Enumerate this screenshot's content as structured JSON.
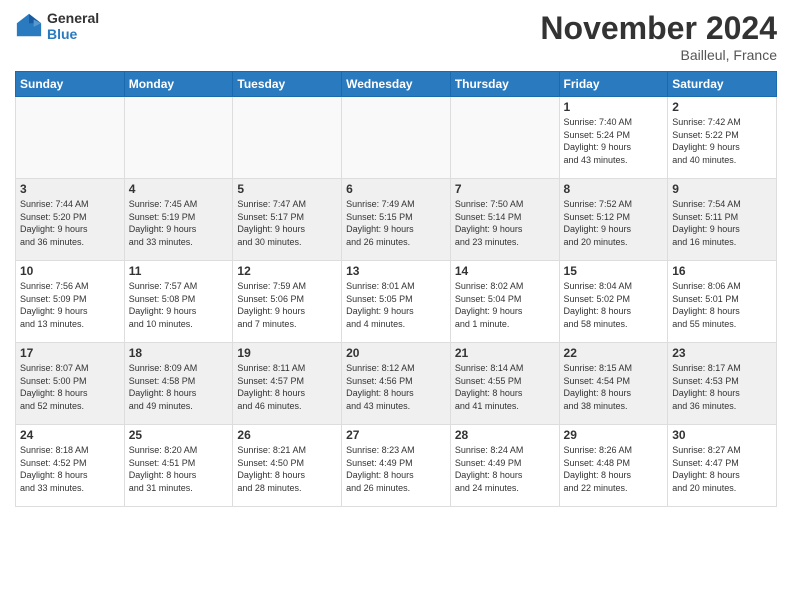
{
  "header": {
    "logo_line1": "General",
    "logo_line2": "Blue",
    "month": "November 2024",
    "location": "Bailleul, France"
  },
  "weekdays": [
    "Sunday",
    "Monday",
    "Tuesday",
    "Wednesday",
    "Thursday",
    "Friday",
    "Saturday"
  ],
  "weeks": [
    [
      {
        "day": "",
        "info": ""
      },
      {
        "day": "",
        "info": ""
      },
      {
        "day": "",
        "info": ""
      },
      {
        "day": "",
        "info": ""
      },
      {
        "day": "",
        "info": ""
      },
      {
        "day": "1",
        "info": "Sunrise: 7:40 AM\nSunset: 5:24 PM\nDaylight: 9 hours\nand 43 minutes."
      },
      {
        "day": "2",
        "info": "Sunrise: 7:42 AM\nSunset: 5:22 PM\nDaylight: 9 hours\nand 40 minutes."
      }
    ],
    [
      {
        "day": "3",
        "info": "Sunrise: 7:44 AM\nSunset: 5:20 PM\nDaylight: 9 hours\nand 36 minutes."
      },
      {
        "day": "4",
        "info": "Sunrise: 7:45 AM\nSunset: 5:19 PM\nDaylight: 9 hours\nand 33 minutes."
      },
      {
        "day": "5",
        "info": "Sunrise: 7:47 AM\nSunset: 5:17 PM\nDaylight: 9 hours\nand 30 minutes."
      },
      {
        "day": "6",
        "info": "Sunrise: 7:49 AM\nSunset: 5:15 PM\nDaylight: 9 hours\nand 26 minutes."
      },
      {
        "day": "7",
        "info": "Sunrise: 7:50 AM\nSunset: 5:14 PM\nDaylight: 9 hours\nand 23 minutes."
      },
      {
        "day": "8",
        "info": "Sunrise: 7:52 AM\nSunset: 5:12 PM\nDaylight: 9 hours\nand 20 minutes."
      },
      {
        "day": "9",
        "info": "Sunrise: 7:54 AM\nSunset: 5:11 PM\nDaylight: 9 hours\nand 16 minutes."
      }
    ],
    [
      {
        "day": "10",
        "info": "Sunrise: 7:56 AM\nSunset: 5:09 PM\nDaylight: 9 hours\nand 13 minutes."
      },
      {
        "day": "11",
        "info": "Sunrise: 7:57 AM\nSunset: 5:08 PM\nDaylight: 9 hours\nand 10 minutes."
      },
      {
        "day": "12",
        "info": "Sunrise: 7:59 AM\nSunset: 5:06 PM\nDaylight: 9 hours\nand 7 minutes."
      },
      {
        "day": "13",
        "info": "Sunrise: 8:01 AM\nSunset: 5:05 PM\nDaylight: 9 hours\nand 4 minutes."
      },
      {
        "day": "14",
        "info": "Sunrise: 8:02 AM\nSunset: 5:04 PM\nDaylight: 9 hours\nand 1 minute."
      },
      {
        "day": "15",
        "info": "Sunrise: 8:04 AM\nSunset: 5:02 PM\nDaylight: 8 hours\nand 58 minutes."
      },
      {
        "day": "16",
        "info": "Sunrise: 8:06 AM\nSunset: 5:01 PM\nDaylight: 8 hours\nand 55 minutes."
      }
    ],
    [
      {
        "day": "17",
        "info": "Sunrise: 8:07 AM\nSunset: 5:00 PM\nDaylight: 8 hours\nand 52 minutes."
      },
      {
        "day": "18",
        "info": "Sunrise: 8:09 AM\nSunset: 4:58 PM\nDaylight: 8 hours\nand 49 minutes."
      },
      {
        "day": "19",
        "info": "Sunrise: 8:11 AM\nSunset: 4:57 PM\nDaylight: 8 hours\nand 46 minutes."
      },
      {
        "day": "20",
        "info": "Sunrise: 8:12 AM\nSunset: 4:56 PM\nDaylight: 8 hours\nand 43 minutes."
      },
      {
        "day": "21",
        "info": "Sunrise: 8:14 AM\nSunset: 4:55 PM\nDaylight: 8 hours\nand 41 minutes."
      },
      {
        "day": "22",
        "info": "Sunrise: 8:15 AM\nSunset: 4:54 PM\nDaylight: 8 hours\nand 38 minutes."
      },
      {
        "day": "23",
        "info": "Sunrise: 8:17 AM\nSunset: 4:53 PM\nDaylight: 8 hours\nand 36 minutes."
      }
    ],
    [
      {
        "day": "24",
        "info": "Sunrise: 8:18 AM\nSunset: 4:52 PM\nDaylight: 8 hours\nand 33 minutes."
      },
      {
        "day": "25",
        "info": "Sunrise: 8:20 AM\nSunset: 4:51 PM\nDaylight: 8 hours\nand 31 minutes."
      },
      {
        "day": "26",
        "info": "Sunrise: 8:21 AM\nSunset: 4:50 PM\nDaylight: 8 hours\nand 28 minutes."
      },
      {
        "day": "27",
        "info": "Sunrise: 8:23 AM\nSunset: 4:49 PM\nDaylight: 8 hours\nand 26 minutes."
      },
      {
        "day": "28",
        "info": "Sunrise: 8:24 AM\nSunset: 4:49 PM\nDaylight: 8 hours\nand 24 minutes."
      },
      {
        "day": "29",
        "info": "Sunrise: 8:26 AM\nSunset: 4:48 PM\nDaylight: 8 hours\nand 22 minutes."
      },
      {
        "day": "30",
        "info": "Sunrise: 8:27 AM\nSunset: 4:47 PM\nDaylight: 8 hours\nand 20 minutes."
      }
    ]
  ]
}
